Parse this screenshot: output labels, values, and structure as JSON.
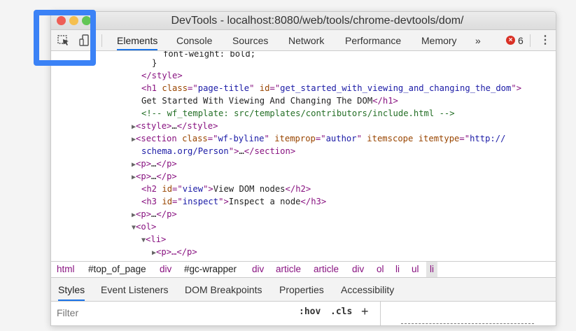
{
  "window": {
    "title": "DevTools - localhost:8080/web/tools/chrome-devtools/dom/"
  },
  "toolbar": {
    "select_icon": "inspect-element-icon",
    "device_icon": "device-toolbar-icon",
    "tabs": [
      "Elements",
      "Console",
      "Sources",
      "Network",
      "Performance",
      "Memory"
    ],
    "more": "»",
    "error_count": "6",
    "error_icon": "×",
    "menu": "⋮"
  },
  "dom": {
    "l1": "font-weight: bold;",
    "l2": "}",
    "l3_tag": "</style>",
    "l4": {
      "open": "<h1 ",
      "a1": "class",
      "eq1": "=\"",
      "v1": "page-title",
      "q1": "\" ",
      "a2": "id",
      "eq2": "=\"",
      "v2": "get_started_with_viewing_and_changing_the_dom",
      "close": "\">"
    },
    "l5": {
      "text": "Get Started With Viewing And Changing The DOM",
      "close": "</h1>"
    },
    "l6": "<!-- wf_template: src/templates/contributors/include.html -->",
    "l7": {
      "open": "<style>",
      "ell": "…",
      "close": "</style>"
    },
    "l8": {
      "open": "<section ",
      "a1": "class",
      "v1": "wf-byline",
      "a2": "itemprop",
      "v2": "author",
      "a3": "itemscope",
      "a4": "itemtype",
      "v4a": "http://"
    },
    "l9": {
      "v4b": "schema.org/Person",
      "ell": "…",
      "close": "</section>"
    },
    "l10": {
      "open": "<p>",
      "ell": "…",
      "close": "</p>"
    },
    "l11": {
      "open": "<p>",
      "ell": "…",
      "close": "</p>"
    },
    "l12": {
      "open": "<h2 ",
      "a1": "id",
      "v1": "view",
      "text": "View DOM nodes",
      "close": "</h2>"
    },
    "l13": {
      "open": "<h3 ",
      "a1": "id",
      "v1": "inspect",
      "text": "Inspect a node",
      "close": "</h3>"
    },
    "l14": {
      "open": "<p>",
      "ell": "…",
      "close": "</p>"
    },
    "l15": "<ol>",
    "l16": "<li>",
    "l17": "<p>…</p>"
  },
  "breadcrumbs": [
    "html",
    "#top_of_page",
    "div",
    "#gc-wrapper",
    "div",
    "article",
    "article",
    "div",
    "ol",
    "li",
    "ul",
    "li"
  ],
  "subtabs": [
    "Styles",
    "Event Listeners",
    "DOM Breakpoints",
    "Properties",
    "Accessibility"
  ],
  "filter": {
    "placeholder": "Filter",
    "hov": ":hov",
    "cls": ".cls",
    "add": "+"
  }
}
